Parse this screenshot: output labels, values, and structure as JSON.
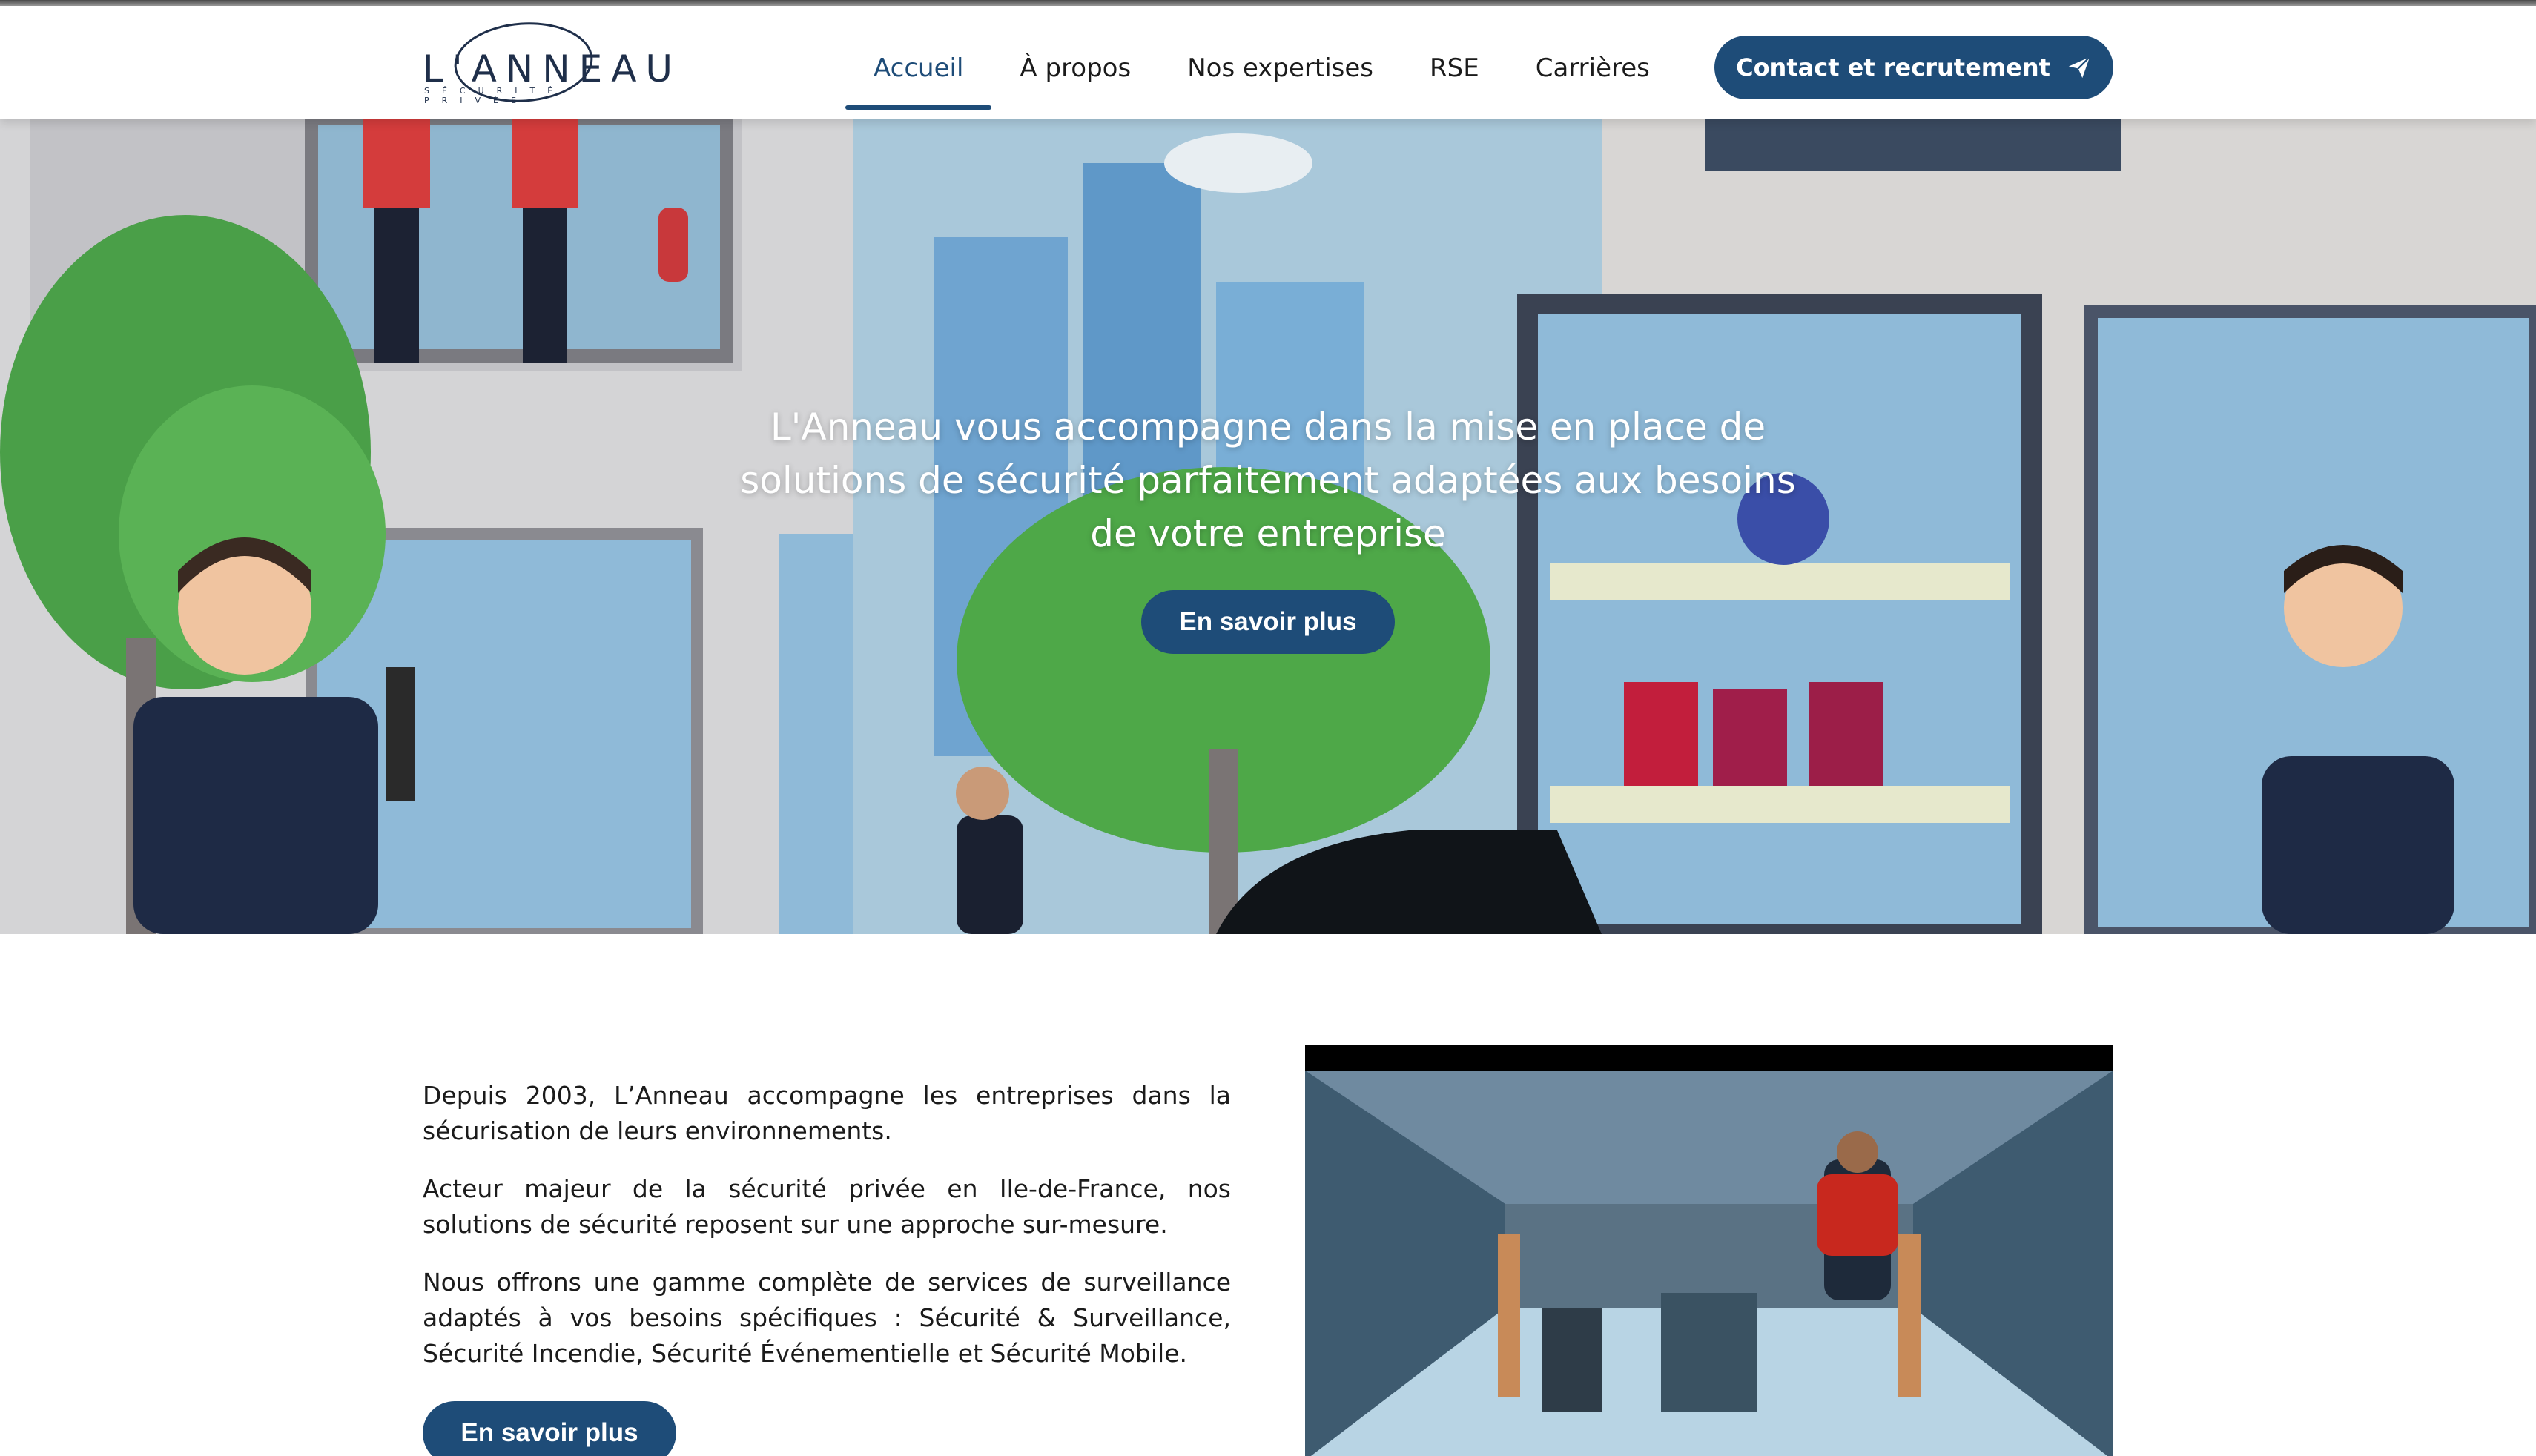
{
  "header": {
    "logo": {
      "word": "L'ANNEAU",
      "subtitle": "SÉCURITÉ PRIVÉE"
    },
    "nav": [
      {
        "label": "Accueil",
        "active": true
      },
      {
        "label": "À propos",
        "active": false
      },
      {
        "label": "Nos expertises",
        "active": false
      },
      {
        "label": "RSE",
        "active": false
      },
      {
        "label": "Carrières",
        "active": false
      }
    ],
    "cta_label": "Contact et recrutement",
    "cta_icon": "paper-plane-icon"
  },
  "hero": {
    "line1": "L'Anneau vous accompagne dans la mise en place de",
    "line2": "solutions de sécurité parfaitement adaptées aux besoins",
    "line3": "de votre entreprise",
    "button_label": "En savoir plus"
  },
  "intro": {
    "p1": "Depuis 2003, L’Anneau accompagne les entreprises dans la sécurisation de leurs environnements.",
    "p2": "Acteur majeur de la sécurité privée en Ile-de-France, nos solutions de sécurité reposent sur une approche sur-mesure.",
    "p3": "Nous offrons une gamme complète de services de surveillance adaptés à vos besoins spécifiques : Sécurité & Surveillance, Sécurité Incendie, Sécurité Événementielle et Sécurité Mobile.",
    "button_label": "En savoir plus"
  },
  "colors": {
    "brand": "#1e4c78",
    "text": "#1b1b1b",
    "background": "#ffffff"
  }
}
